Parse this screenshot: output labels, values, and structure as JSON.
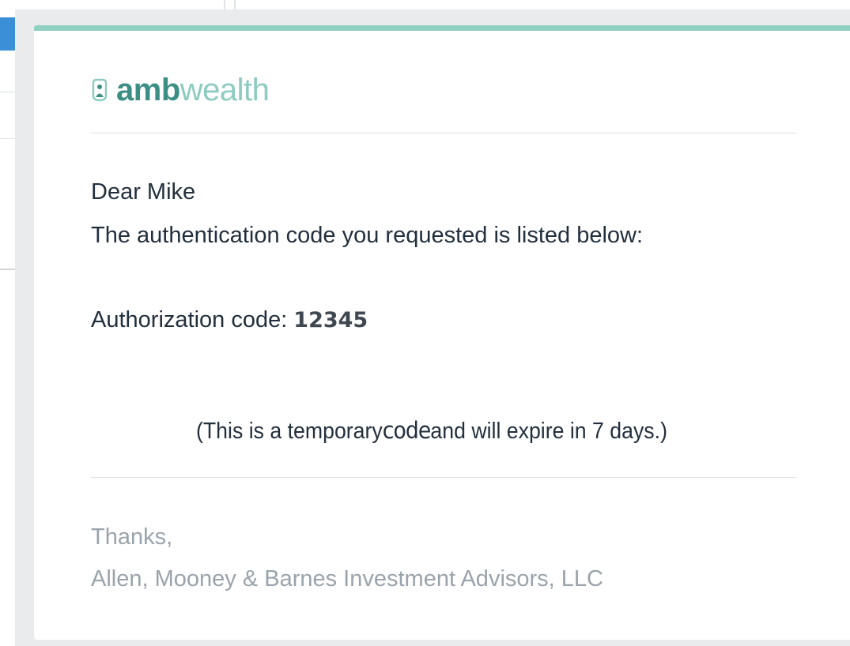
{
  "email": {
    "brand": {
      "logo_bold": "amb",
      "logo_light": "wealth",
      "icon": "shield-person-icon",
      "accent_color": "#8fd0c1",
      "logo_color": "#3d8f85"
    },
    "greeting": "Dear Mike",
    "intro": "The authentication code you requested is listed below:",
    "auth_label": "Authorization code:",
    "auth_code": "12345",
    "expiry_prefix": "(This is a temporary",
    "expiry_code_word": "code",
    "expiry_suffix": "and will expire in 7 days.)",
    "thanks": "Thanks,",
    "signature": "Allen, Mooney & Barnes Investment Advisors, LLC"
  }
}
